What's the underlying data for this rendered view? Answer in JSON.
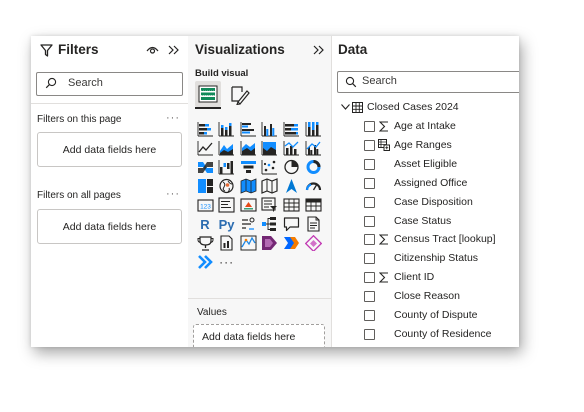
{
  "filters": {
    "title": "Filters",
    "search_placeholder": "Search",
    "on_this_page_label": "Filters on this page",
    "on_all_pages_label": "Filters on all pages",
    "well_placeholder": "Add data fields here",
    "more_options": "···"
  },
  "visualizations": {
    "title": "Visualizations",
    "build_visual_label": "Build visual",
    "r_label": "R",
    "py_label": "Py",
    "more_visuals": "···",
    "values_label": "Values",
    "values_placeholder": "Add data fields here",
    "icons": [
      "stacked-bar-chart-icon",
      "stacked-column-chart-icon",
      "clustered-bar-chart-icon",
      "clustered-column-chart-icon",
      "100-stacked-bar-chart-icon",
      "100-stacked-column-chart-icon",
      "line-chart-icon",
      "area-chart-icon",
      "stacked-area-chart-icon",
      "100-stacked-area-chart-icon",
      "line-and-stacked-column-chart-icon",
      "line-and-clustered-column-chart-icon",
      "ribbon-chart-icon",
      "waterfall-chart-icon",
      "funnel-chart-icon",
      "scatter-chart-icon",
      "pie-chart-icon",
      "donut-chart-icon",
      "treemap-icon",
      "map-icon",
      "filled-map-icon",
      "shape-map-icon",
      "azure-map-icon",
      "gauge-icon",
      "card-icon",
      "multi-row-card-icon",
      "kpi-icon",
      "slicer-icon",
      "table-icon",
      "matrix-icon",
      "r-script-visual-icon",
      "python-visual-icon",
      "key-influencers-icon",
      "decomposition-tree-icon",
      "qa-icon",
      "smart-narrative-icon",
      "metrics-icon",
      "paginated-report-icon",
      "arcgis-map-icon",
      "power-apps-icon",
      "power-automate-icon",
      "custom-visual-icon",
      "get-more-visuals-icon",
      "more-options-icon"
    ]
  },
  "data": {
    "title": "Data",
    "search_placeholder": "Search",
    "table": {
      "name": "Closed Cases 2024",
      "fields": [
        {
          "label": "Age at Intake",
          "icon": "sigma-icon"
        },
        {
          "label": "Age Ranges",
          "icon": "group-icon"
        },
        {
          "label": "Asset Eligible",
          "icon": ""
        },
        {
          "label": "Assigned Office",
          "icon": ""
        },
        {
          "label": "Case Disposition",
          "icon": ""
        },
        {
          "label": "Case Status",
          "icon": ""
        },
        {
          "label": "Census Tract [lookup]",
          "icon": "sigma-icon"
        },
        {
          "label": "Citizenship Status",
          "icon": ""
        },
        {
          "label": "Client ID",
          "icon": "sigma-icon"
        },
        {
          "label": "Close Reason",
          "icon": ""
        },
        {
          "label": "County of Dispute",
          "icon": ""
        },
        {
          "label": "County of Residence",
          "icon": ""
        }
      ]
    }
  }
}
